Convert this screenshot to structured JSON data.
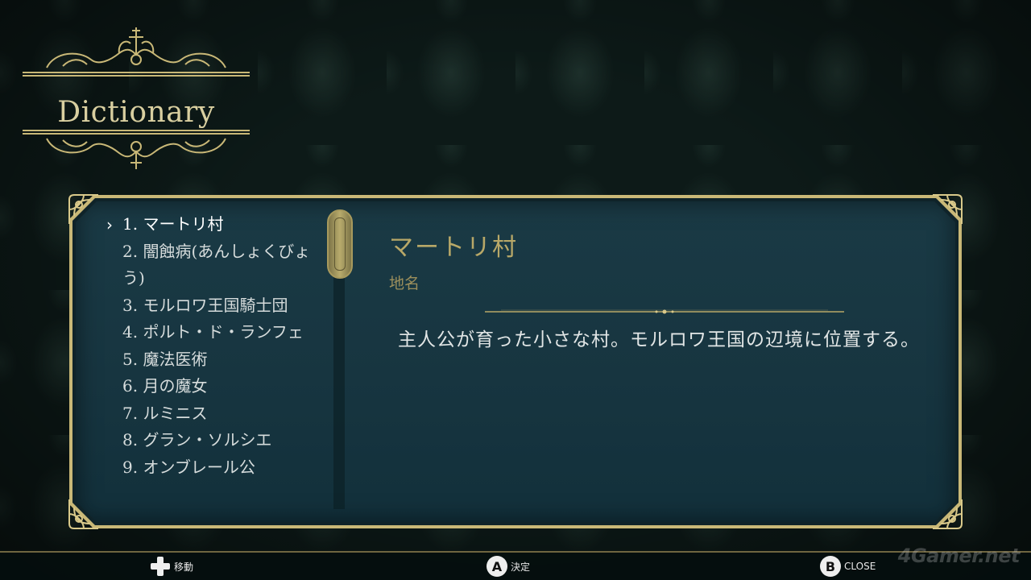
{
  "header": {
    "title": "Dictionary"
  },
  "entries": [
    {
      "label": "1. マートリ村",
      "selected": true
    },
    {
      "label": "2. 闇蝕病(あんしょくびょう)",
      "selected": false
    },
    {
      "label": "3. モルロワ王国騎士団",
      "selected": false
    },
    {
      "label": "4. ポルト・ド・ランフェ",
      "selected": false
    },
    {
      "label": "5. 魔法医術",
      "selected": false
    },
    {
      "label": "6. 月の魔女",
      "selected": false
    },
    {
      "label": "7. ルミニス",
      "selected": false
    },
    {
      "label": "8. グラン・ソルシエ",
      "selected": false
    },
    {
      "label": "9. オンブレール公",
      "selected": false
    }
  ],
  "cursor": {
    "glyph": "›",
    "icon": "chevron-right-icon"
  },
  "scrollbar": {
    "position_fraction": 0.0
  },
  "detail": {
    "title": "マートリ村",
    "category": "地名",
    "body": "主人公が育った小さな村。モルロワ王国の辺境に位置する。"
  },
  "controls": {
    "move": {
      "icon": "dpad-icon",
      "label": "移動"
    },
    "confirm": {
      "button": "A",
      "label": "決定"
    },
    "close": {
      "button": "B",
      "label": "CLOSE"
    }
  },
  "watermark": "4Gamer.net",
  "colors": {
    "accent_gold": "#c9b877",
    "panel_bg": "#1a3a45",
    "detail_title": "#b8a868",
    "text": "#e2e6e6"
  }
}
